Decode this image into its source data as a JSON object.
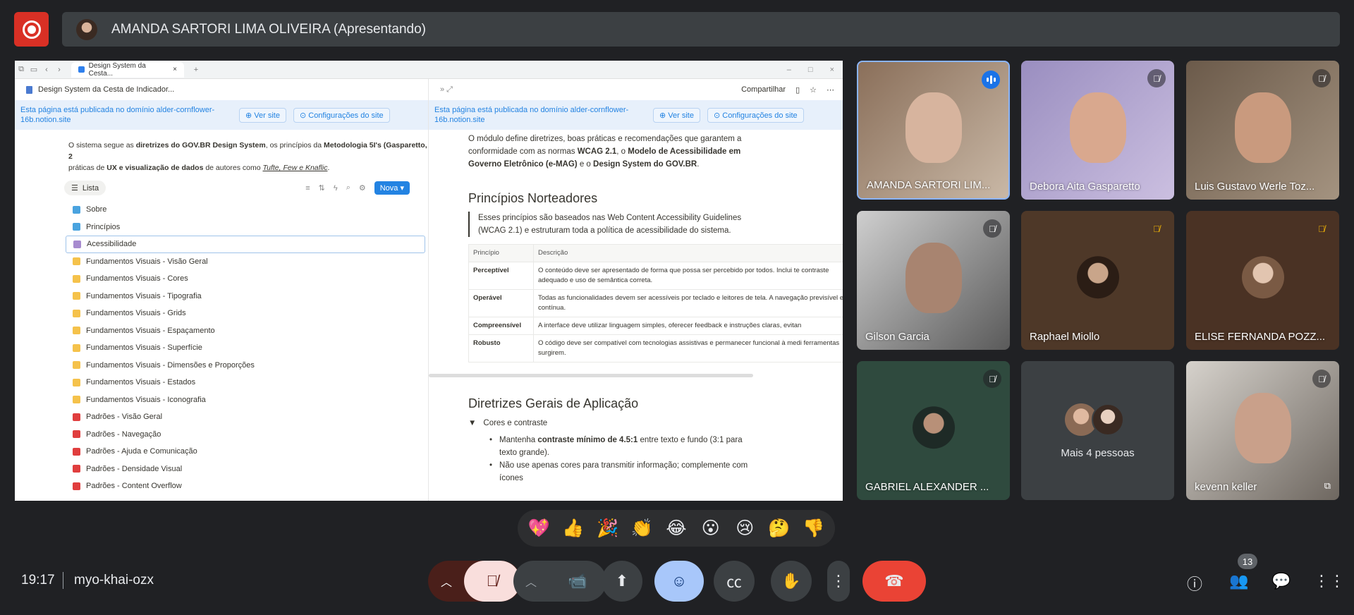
{
  "presenter": {
    "name": "AMANDA SARTORI LIMA OLIVEIRA (Apresentando)"
  },
  "browser": {
    "tab_title": "Design System da Cesta..."
  },
  "left_pane": {
    "breadcrumb": "Design System da Cesta de Indicador...",
    "banner_text": "Esta página está publicada no domínio alder-cornflower-16b.notion.site",
    "view_site": "Ver site",
    "site_settings": "Configurações do site",
    "intro_a": "O sistema segue as ",
    "intro_b": "diretrizes do GOV.BR Design System",
    "intro_c": ", os princípios da ",
    "intro_d": "Metodologia 5I's (Gasparetto, 2",
    "intro_e": "práticas de ",
    "intro_f": "UX e visualização de dados",
    "intro_g": " de autores como ",
    "intro_h": "Tufte, Few e Knaflic",
    "db_view": "Lista",
    "new_button": "Nova",
    "items": [
      {
        "label": "Sobre",
        "color": "#4aa3df"
      },
      {
        "label": "Princípios",
        "color": "#4aa3df"
      },
      {
        "label": "Acessibilidade",
        "color": "#a78bcf"
      },
      {
        "label": "Fundamentos Visuais - Visão Geral",
        "color": "#f5c24b"
      },
      {
        "label": "Fundamentos Visuais - Cores",
        "color": "#f5c24b"
      },
      {
        "label": "Fundamentos Visuais - Tipografia",
        "color": "#f5c24b"
      },
      {
        "label": "Fundamentos Visuais - Grids",
        "color": "#f5c24b"
      },
      {
        "label": "Fundamentos Visuais - Espaçamento",
        "color": "#f5c24b"
      },
      {
        "label": "Fundamentos Visuais - Superfície",
        "color": "#f5c24b"
      },
      {
        "label": "Fundamentos Visuais - Dimensões e Proporções",
        "color": "#f5c24b"
      },
      {
        "label": "Fundamentos Visuais - Estados",
        "color": "#f5c24b"
      },
      {
        "label": "Fundamentos Visuais - Iconografia",
        "color": "#f5c24b"
      },
      {
        "label": "Padrões - Visão Geral",
        "color": "#e03e3e"
      },
      {
        "label": "Padrões - Navegação",
        "color": "#e03e3e"
      },
      {
        "label": "Padrões - Ajuda e Comunicação",
        "color": "#e03e3e"
      },
      {
        "label": "Padrões - Densidade Visual",
        "color": "#e03e3e"
      },
      {
        "label": "Padrões - Content Overflow",
        "color": "#e03e3e"
      }
    ]
  },
  "right_pane": {
    "share": "Compartilhar",
    "banner_text": "Esta página está publicada no domínio alder-cornflower-16b.notion.site",
    "view_site": "Ver site",
    "site_settings": "Configurações do site",
    "para_a": "O módulo define diretrizes, boas práticas e recomendações que garantem a conformidade com as normas ",
    "para_b": "WCAG 2.1",
    "para_c": ", o ",
    "para_d": "Modelo de Acessibilidade em Governo Eletrônico (e-MAG)",
    "para_e": " e o ",
    "para_f": "Design System do GOV.BR",
    "para_g": ".",
    "heading1": "Princípios Norteadores",
    "quote": "Esses princípios são baseados nas Web Content Accessibility Guidelines (WCAG 2.1) e estruturam toda a política de acessibilidade do sistema.",
    "table_headers": [
      "Princípio",
      "Descrição"
    ],
    "table_rows": [
      {
        "k": "Perceptível",
        "v": "O conteúdo deve ser apresentado de forma que possa ser percebido por todos. Inclui te contraste adequado e uso de semântica correta."
      },
      {
        "k": "Operável",
        "v": "Todas as funcionalidades devem ser acessíveis por teclado e leitores de tela. A navegação previsível e contínua."
      },
      {
        "k": "Compreensível",
        "v": "A interface deve utilizar linguagem simples, oferecer feedback e instruções claras, evitan"
      },
      {
        "k": "Robusto",
        "v": "O código deve ser compatível com tecnologias assistivas e permanecer funcional à medi ferramentas surgirem."
      }
    ],
    "heading2": "Diretrizes Gerais de Aplicação",
    "toggle": "Cores e contraste",
    "bullet1_a": "Mantenha ",
    "bullet1_b": "contraste mínimo de 4.5:1",
    "bullet1_c": " entre texto e fundo (3:1 para texto grande).",
    "bullet2": "Não use apenas cores para transmitir informação; complemente com ícones"
  },
  "participants": [
    {
      "name": "AMANDA SARTORI LIM...",
      "muted": false,
      "speaking": true
    },
    {
      "name": "Debora Aita Gasparetto",
      "muted": true
    },
    {
      "name": "Luis Gustavo Werle Toz...",
      "muted": true
    },
    {
      "name": "Gilson Garcia",
      "muted": true
    },
    {
      "name": "Raphael Miollo",
      "muted": true
    },
    {
      "name": "ELISE FERNANDA POZZ...",
      "muted": true
    },
    {
      "name": "GABRIEL ALEXANDER ...",
      "muted": true
    },
    {
      "name": "Mais 4 pessoas"
    },
    {
      "name": "kevenn keller",
      "muted": true
    }
  ],
  "reactions": [
    "💖",
    "👍",
    "🎉",
    "👏",
    "😂",
    "😮",
    "😢",
    "🤔",
    "👎"
  ],
  "meeting": {
    "time": "19:17",
    "code": "myo-khai-ozx",
    "people_count": "13"
  }
}
